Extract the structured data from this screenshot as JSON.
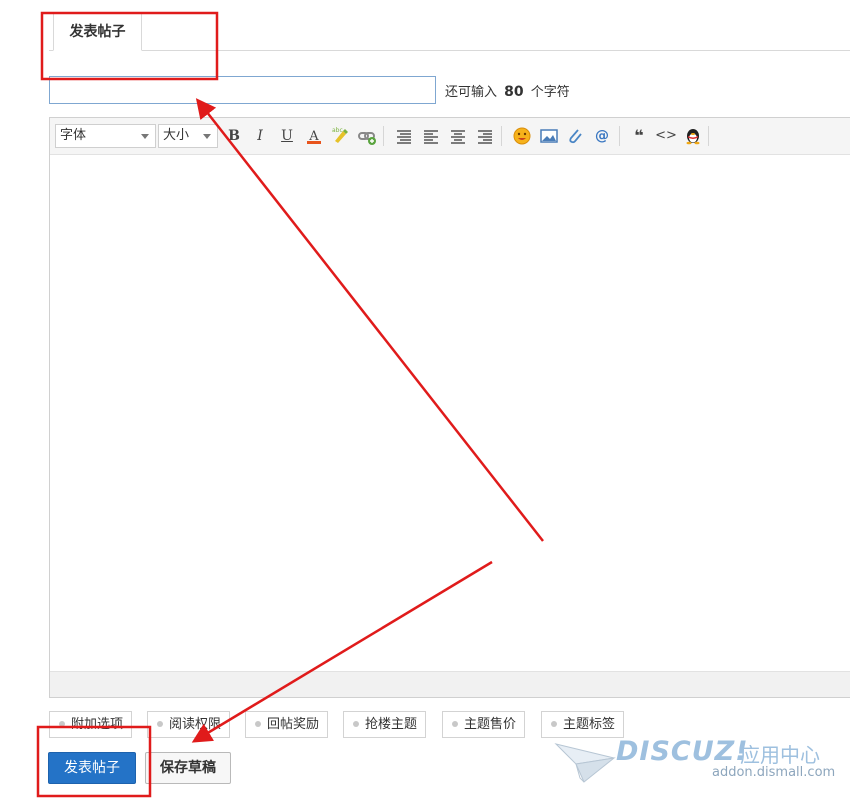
{
  "tabs": {
    "active_label": "发表帖子"
  },
  "title_field": {
    "value": "",
    "placeholder": ""
  },
  "char_hint": {
    "prefix": "还可输入",
    "count": "80",
    "suffix": "个字符"
  },
  "toolbar": {
    "font_label": "字体",
    "size_label": "大小",
    "bold_glyph": "B",
    "italic_glyph": "I",
    "underline_glyph": "U",
    "color_glyph": "A",
    "quote_glyph": "❝",
    "code_glyph": "<>"
  },
  "options": [
    {
      "label": "附加选项"
    },
    {
      "label": "阅读权限"
    },
    {
      "label": "回帖奖励"
    },
    {
      "label": "抢楼主题"
    },
    {
      "label": "主题售价"
    },
    {
      "label": "主题标签"
    }
  ],
  "actions": {
    "post_label": "发表帖子",
    "draft_label": "保存草稿"
  },
  "watermark": {
    "brand": "DISCUZ!",
    "cn": "应用中心",
    "url": "addon.dismall.com"
  },
  "colors": {
    "annotation": "#e01b1b",
    "primary": "#2473c7",
    "watermark": "#9ec0df"
  }
}
